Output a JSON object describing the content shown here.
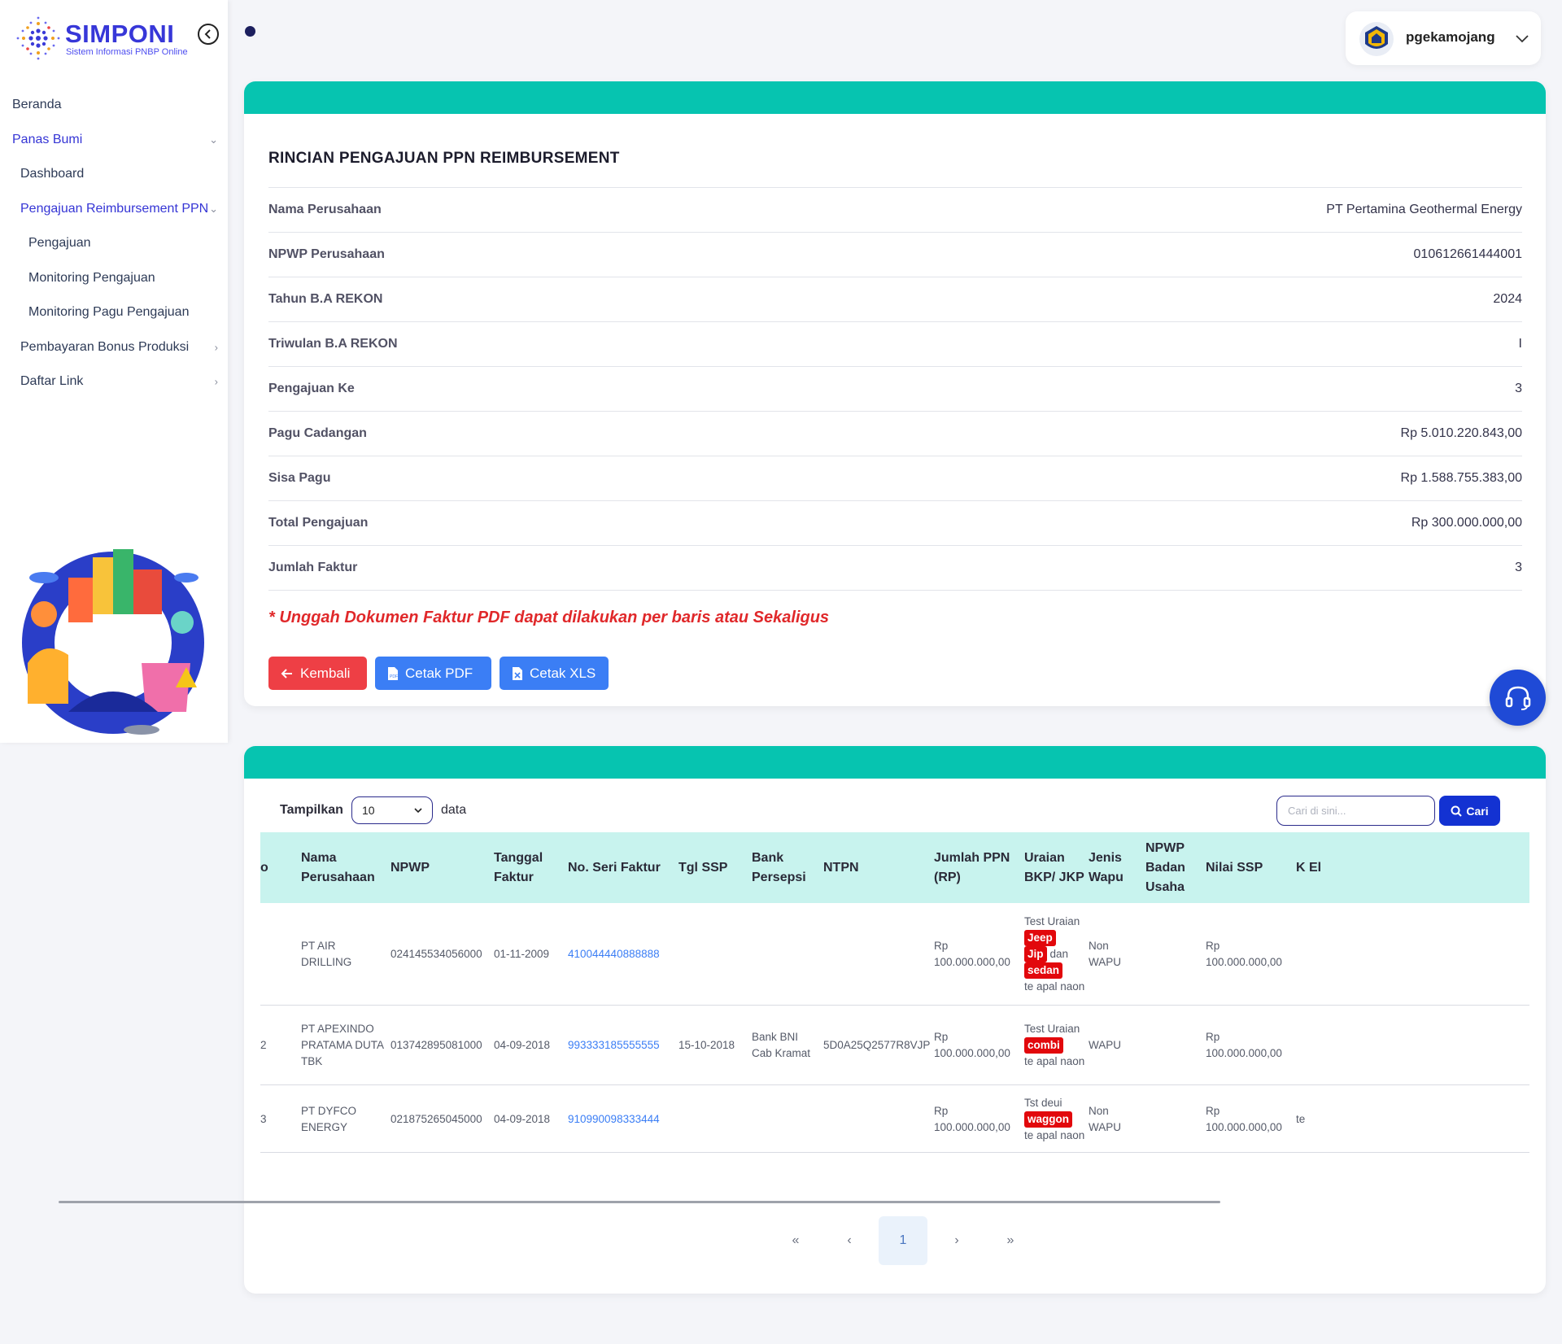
{
  "app": {
    "name": "SIMPONI",
    "tagline": "Sistem Informasi PNBP Online"
  },
  "user": {
    "name": "pgekamojang"
  },
  "sidebar": {
    "items": [
      {
        "label": "Beranda",
        "level": 0,
        "active": false,
        "chevron": ""
      },
      {
        "label": "Panas Bumi",
        "level": 0,
        "active": true,
        "chevron": "⌄"
      },
      {
        "label": "Dashboard",
        "level": 1,
        "active": false,
        "chevron": ""
      },
      {
        "label": "Pengajuan Reimbursement PPN",
        "level": 1,
        "active": true,
        "chevron": "⌄"
      },
      {
        "label": "Pengajuan",
        "level": 2,
        "active": false,
        "chevron": ""
      },
      {
        "label": "Monitoring Pengajuan",
        "level": 2,
        "active": false,
        "chevron": ""
      },
      {
        "label": "Monitoring Pagu Pengajuan",
        "level": 2,
        "active": false,
        "chevron": ""
      },
      {
        "label": "Pembayaran Bonus Produksi",
        "level": 1,
        "active": false,
        "chevron": "›"
      },
      {
        "label": "Daftar Link",
        "level": 1,
        "active": false,
        "chevron": "›"
      }
    ]
  },
  "detail": {
    "title": "RINCIAN PENGAJUAN PPN REIMBURSEMENT",
    "rows": [
      {
        "label": "Nama Perusahaan",
        "value": "PT Pertamina Geothermal Energy"
      },
      {
        "label": "NPWP Perusahaan",
        "value": "010612661444001"
      },
      {
        "label": "Tahun B.A REKON",
        "value": "2024"
      },
      {
        "label": "Triwulan B.A REKON",
        "value": "I"
      },
      {
        "label": "Pengajuan Ke",
        "value": "3"
      },
      {
        "label": "Pagu Cadangan",
        "value": "Rp 5.010.220.843,00"
      },
      {
        "label": "Sisa Pagu",
        "value": "Rp 1.588.755.383,00"
      },
      {
        "label": "Total Pengajuan",
        "value": "Rp 300.000.000,00"
      },
      {
        "label": "Jumlah Faktur",
        "value": "3"
      }
    ],
    "note": "* Unggah Dokumen Faktur PDF dapat dilakukan per baris atau Sekaligus",
    "buttons": {
      "back": "Kembali",
      "pdf": "Cetak PDF",
      "xls": "Cetak XLS"
    }
  },
  "table": {
    "show_label": "Tampilkan",
    "page_size": "10",
    "data_label": "data",
    "search_placeholder": "Cari di sini...",
    "search_button": "Cari",
    "columns": [
      "o",
      "Nama Perusahaan",
      "NPWP",
      "Tanggal Faktur",
      "No. Seri Faktur",
      "Tgl SSP",
      "Bank Persepsi",
      "NTPN",
      "Jumlah PPN (RP)",
      "Uraian BKP/ JKP",
      "Jenis Wapu",
      "NPWP Badan Usaha",
      "Nilai SSP",
      "K El"
    ],
    "rows": [
      {
        "no": "",
        "nama": "PT AIR DRILLING",
        "npwp": "024145534056000",
        "tanggal": "01-11-2009",
        "seri": "410044440888888",
        "tgl_ssp": "",
        "bank": "",
        "ntpn": "",
        "jumlah": "Rp 100.000.000,00",
        "uraian_pre": "Test Uraian",
        "tags": [
          "Jeep",
          "Jip",
          "sedan"
        ],
        "uraian_mid": "dan",
        "uraian_post": "te apal naon",
        "wapu": "Non WAPU",
        "npwp_bu": "",
        "nilai": "Rp 100.000.000,00",
        "k": ""
      },
      {
        "no": "2",
        "nama": "PT APEXINDO PRATAMA DUTA TBK",
        "npwp": "013742895081000",
        "tanggal": "04-09-2018",
        "seri": "993333185555555",
        "tgl_ssp": "15-10-2018",
        "bank": "Bank BNI Cab Kramat",
        "ntpn": "5D0A25Q2577R8VJP",
        "jumlah": "Rp 100.000.000,00",
        "uraian_pre": "Test Uraian",
        "tags": [
          "combi"
        ],
        "uraian_post": "te apal naon",
        "wapu": "WAPU",
        "npwp_bu": "",
        "nilai": "Rp 100.000.000,00",
        "k": ""
      },
      {
        "no": "3",
        "nama": "PT DYFCO ENERGY",
        "npwp": "021875265045000",
        "tanggal": "04-09-2018",
        "seri": "910990098333444",
        "tgl_ssp": "",
        "bank": "",
        "ntpn": "",
        "jumlah": "Rp 100.000.000,00",
        "uraian_pre": "Tst deui",
        "tags": [
          "waggon"
        ],
        "uraian_post": "te apal naon",
        "wapu": "Non WAPU",
        "npwp_bu": "",
        "nilai": "Rp 100.000.000,00",
        "k": "te"
      }
    ]
  },
  "pagination": {
    "first": "«",
    "prev": "‹",
    "current": "1",
    "next": "›",
    "last": "»"
  },
  "colors": {
    "accent": "#06c4b0",
    "primary": "#3535d5",
    "danger": "#ee3f45",
    "button_blue": "#3b7ef5",
    "table_header": "#c8f3ee"
  },
  "icons": {
    "collapse": "chevron-left-icon",
    "user_menu": "chevron-down-icon",
    "support": "headset-icon",
    "search": "search-icon"
  }
}
